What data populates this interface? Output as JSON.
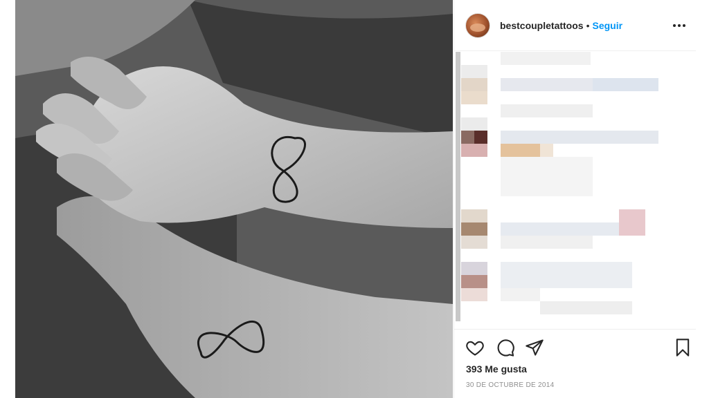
{
  "post": {
    "username": "bestcoupletattoos",
    "separator": "•",
    "follow_label": "Seguir",
    "likes_text": "393 Me gusta",
    "date_text": "30 DE OCTUBRE DE 2014"
  },
  "icons": {
    "more": "more-options-icon",
    "like": "heart-icon",
    "comment": "comment-icon",
    "share": "paper-plane-icon",
    "save": "bookmark-icon"
  },
  "colors": {
    "accent": "#0095f6",
    "text": "#262626",
    "muted": "#8e8e8e"
  }
}
